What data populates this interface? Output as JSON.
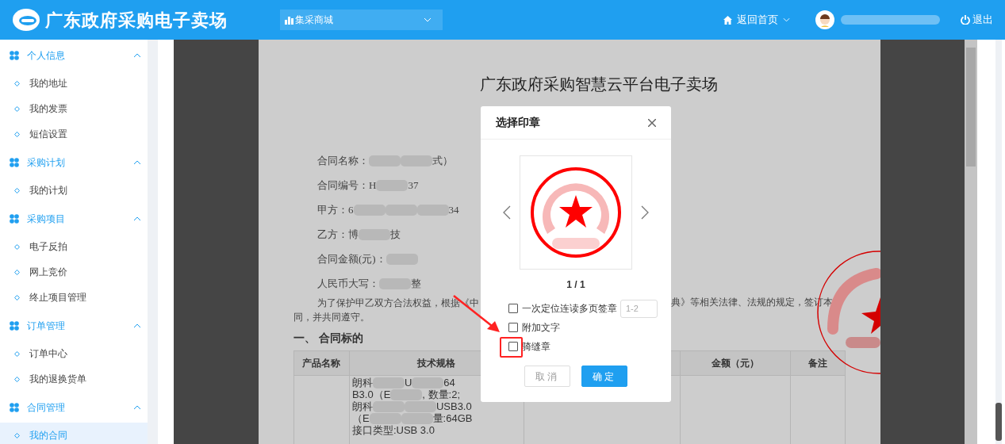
{
  "header": {
    "title": "广东政府采购电子卖场",
    "store_select": {
      "value": "集采商城"
    },
    "home_link": "返回首页",
    "logout": "退出"
  },
  "sidebar": {
    "groups": [
      {
        "label": "个人信息",
        "expanded": true,
        "items": [
          {
            "label": "我的地址",
            "selected": false
          },
          {
            "label": "我的发票",
            "selected": false
          },
          {
            "label": "短信设置",
            "selected": false
          }
        ]
      },
      {
        "label": "采购计划",
        "expanded": true,
        "items": [
          {
            "label": "我的计划",
            "selected": false
          }
        ]
      },
      {
        "label": "采购项目",
        "expanded": true,
        "items": [
          {
            "label": "电子反拍",
            "selected": false
          },
          {
            "label": "网上竞价",
            "selected": false
          },
          {
            "label": "终止项目管理",
            "selected": false
          }
        ]
      },
      {
        "label": "订单管理",
        "expanded": true,
        "items": [
          {
            "label": "订单中心",
            "selected": false
          },
          {
            "label": "我的退换货单",
            "selected": false
          }
        ]
      },
      {
        "label": "合同管理",
        "expanded": true,
        "items": [
          {
            "label": "我的合同",
            "selected": true
          }
        ]
      }
    ]
  },
  "document": {
    "title": "广东政府采购智慧云平台电子卖场",
    "fields": [
      [
        {
          "kind": "text",
          "text": "合同名称："
        },
        {
          "kind": "redacted"
        },
        {
          "kind": "redacted"
        },
        {
          "kind": "text",
          "text": "式）"
        }
      ],
      [
        {
          "kind": "text",
          "text": "合同编号：H"
        },
        {
          "kind": "redacted"
        },
        {
          "kind": "text",
          "text": "37"
        }
      ],
      [
        {
          "kind": "text",
          "text": "甲方：6"
        },
        {
          "kind": "redacted"
        },
        {
          "kind": "redacted"
        },
        {
          "kind": "redacted"
        },
        {
          "kind": "text",
          "text": "34"
        }
      ],
      [
        {
          "kind": "text",
          "text": "乙方：博"
        },
        {
          "kind": "redacted"
        },
        {
          "kind": "text",
          "text": "技"
        }
      ],
      [
        {
          "kind": "text",
          "text": "合同金额(元)："
        },
        {
          "kind": "redacted"
        }
      ],
      [
        {
          "kind": "text",
          "text": "人民币大写："
        },
        {
          "kind": "redacted"
        },
        {
          "kind": "text",
          "text": "整"
        }
      ]
    ],
    "paragraph": {
      "line_1_start": "为了保护甲乙双方合法权益，根据《中",
      "line_1_end": "典》等相关法律、法规的规定，签订本",
      "line_2": "同，并共同遵守。"
    },
    "section_heading": "一、 合同标的",
    "table": {
      "columns": [
        {
          "label": "产品名称"
        },
        {
          "label": "技术规格"
        },
        {
          "obscured": true
        },
        {
          "label": "金额（元）"
        },
        {
          "label": "备注"
        }
      ],
      "spec_lines": [
        [
          {
            "kind": "text",
            "text": "朗科"
          },
          {
            "kind": "redacted"
          },
          {
            "kind": "text",
            "text": "U"
          },
          {
            "kind": "redacted"
          },
          {
            "kind": "text",
            "text": "64"
          }
        ],
        [
          {
            "kind": "text",
            "text": "B3.0（E"
          },
          {
            "kind": "redacted"
          },
          {
            "kind": "text",
            "text": ", 数量:2;"
          }
        ],
        [
          {
            "kind": "text",
            "text": "朗科"
          },
          {
            "kind": "redacted"
          },
          {
            "kind": "redacted"
          },
          {
            "kind": "text",
            "text": "USB3.0"
          }
        ],
        [
          {
            "kind": "text",
            "text": "（E"
          },
          {
            "kind": "redacted"
          },
          {
            "kind": "redacted"
          },
          {
            "kind": "text",
            "text": "量:64GB"
          }
        ],
        [
          {
            "kind": "text",
            "text": "接口类型:USB 3.0"
          }
        ]
      ]
    }
  },
  "modal": {
    "title": "选择印章",
    "page_indicator": "1 / 1",
    "options": [
      {
        "kind": "with_range",
        "label": "一次定位连读多页签章",
        "checked": false,
        "placeholder": "1-2"
      },
      {
        "kind": "plain",
        "label": "附加文字",
        "checked": false
      },
      {
        "kind": "plain",
        "label": "骑缝章",
        "checked": false
      }
    ],
    "buttons": [
      {
        "kind": "secondary",
        "label": "取消"
      },
      {
        "kind": "primary",
        "label": "确定"
      }
    ]
  }
}
